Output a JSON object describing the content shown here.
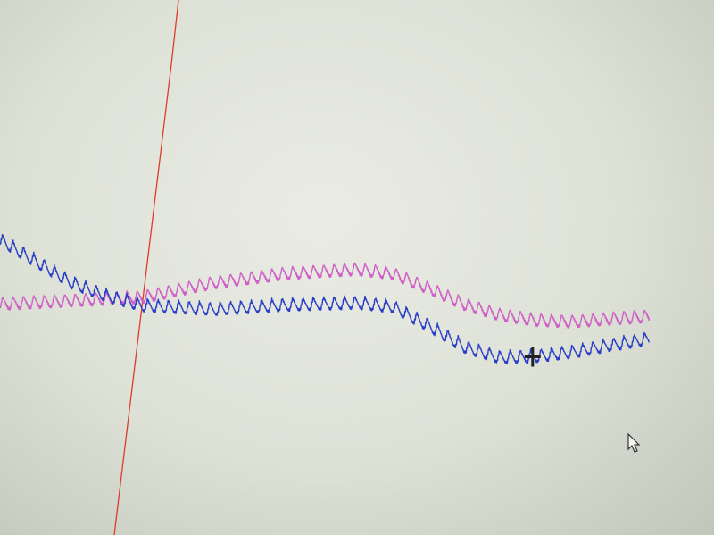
{
  "chart_data": {
    "type": "line",
    "title": "",
    "xlabel": "",
    "ylabel": "",
    "xlim": [
      0,
      100
    ],
    "ylim": [
      0,
      100
    ],
    "grid": false,
    "legend": "none",
    "series": [
      {
        "color": "#e03a2a",
        "x": [
          16,
          17,
          18,
          19,
          20,
          21,
          22,
          23,
          24,
          25
        ],
        "y": [
          0,
          11,
          22,
          33,
          44,
          55,
          66,
          77,
          88,
          100
        ]
      },
      {
        "color": "#d060c8",
        "baseline_x": [
          0,
          20,
          30,
          40,
          50,
          55,
          60,
          65,
          70,
          75,
          80,
          85,
          91
        ],
        "baseline_y": [
          43.0,
          44.3,
          47.0,
          48.7,
          49.5,
          48.7,
          46.0,
          43.0,
          41.0,
          40.0,
          39.7,
          40.2,
          40.7
        ],
        "ripple_period_x": 1.45,
        "ripple_amplitude_y": 2.2
      },
      {
        "color": "#2a3ec8",
        "baseline_x": [
          0,
          5,
          10,
          15,
          20,
          30,
          40,
          50,
          55,
          60,
          65,
          70,
          75,
          80,
          85,
          91
        ],
        "baseline_y": [
          55.0,
          51.0,
          47.0,
          44.5,
          42.7,
          42.0,
          42.8,
          43.2,
          42.5,
          39.0,
          35.0,
          33.0,
          33.2,
          34.0,
          35.2,
          36.5
        ],
        "ripple_period_x": 1.45,
        "ripple_amplitude_y": 2.2
      }
    ],
    "cursor_marker": {
      "x": 74.6,
      "y": 33.3,
      "color": "#222222"
    }
  },
  "icons": {
    "crosshair": "crosshair-cursor-icon",
    "pointer": "mouse-pointer-icon"
  }
}
